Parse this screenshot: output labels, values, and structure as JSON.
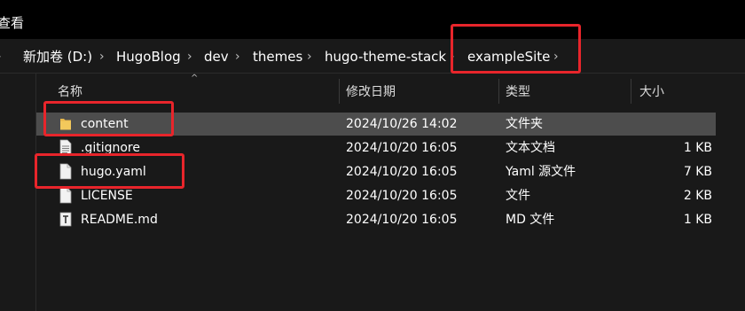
{
  "menu": {
    "view_label": "查看"
  },
  "breadcrumb": {
    "items": [
      "新加卷 (D:)",
      "HugoBlog",
      "dev",
      "themes",
      "hugo-theme-stack",
      "exampleSite"
    ]
  },
  "columns": {
    "name": "名称",
    "date": "修改日期",
    "type": "类型",
    "size": "大小"
  },
  "files": [
    {
      "name": "content",
      "date": "2024/10/26 14:02",
      "type": "文件夹",
      "size": "",
      "icon": "folder-icon"
    },
    {
      "name": ".gitignore",
      "date": "2024/10/20 16:05",
      "type": "文本文档",
      "size": "1 KB",
      "icon": "text-file-icon"
    },
    {
      "name": "hugo.yaml",
      "date": "2024/10/20 16:05",
      "type": "Yaml 源文件",
      "size": "7 KB",
      "icon": "file-icon"
    },
    {
      "name": "LICENSE",
      "date": "2024/10/20 16:05",
      "type": "文件",
      "size": "2 KB",
      "icon": "file-icon"
    },
    {
      "name": "README.md",
      "date": "2024/10/20 16:05",
      "type": "MD 文件",
      "size": "1 KB",
      "icon": "markdown-file-icon"
    }
  ],
  "colors": {
    "highlight_border": "#e8252b",
    "selected_row": "#4d4d4d",
    "folder": "#e8b84a"
  }
}
